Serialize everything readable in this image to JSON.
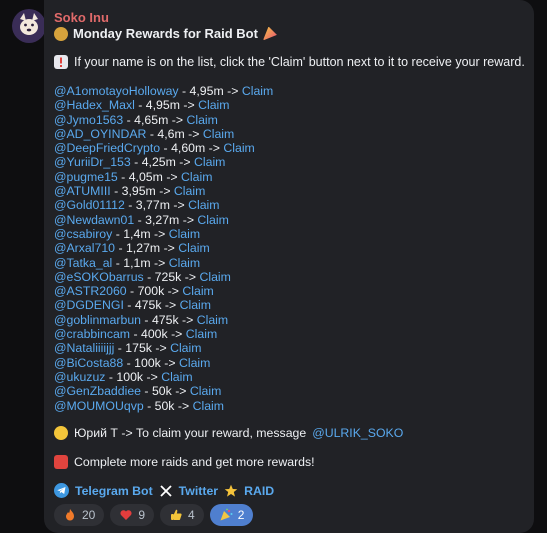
{
  "message": {
    "sender": "Soko Inu",
    "title": "Monday Rewards for Raid Bot",
    "intro": "If your name is on the list, click the 'Claim' button next to it to receive your reward.",
    "arrow": "->",
    "claim_label": "Claim",
    "rewards": [
      {
        "user": "@A1omotayoHolloway",
        "amount": "4,95m"
      },
      {
        "user": "@Hadex_Maxl",
        "amount": "4,95m"
      },
      {
        "user": "@Jymo1563",
        "amount": "4,65m"
      },
      {
        "user": "@AD_OYINDAR",
        "amount": "4,6m"
      },
      {
        "user": "@DeepFriedCrypto",
        "amount": "4,60m"
      },
      {
        "user": "@YuriiDr_153",
        "amount": "4,25m"
      },
      {
        "user": "@pugme15",
        "amount": "4,05m"
      },
      {
        "user": "@ATUMIII",
        "amount": "3,95m"
      },
      {
        "user": "@Gold01112",
        "amount": "3,77m"
      },
      {
        "user": "@Newdawn01",
        "amount": "3,27m"
      },
      {
        "user": "@csabiroy",
        "amount": "1,4m"
      },
      {
        "user": "@Arxal710",
        "amount": "1,27m"
      },
      {
        "user": "@Tatka_al",
        "amount": "1,1m"
      },
      {
        "user": "@eSOKObarrus",
        "amount": "725k"
      },
      {
        "user": "@ASTR2060",
        "amount": "700k"
      },
      {
        "user": "@DGDENGI",
        "amount": "475k"
      },
      {
        "user": "@goblinmarbun",
        "amount": "475k"
      },
      {
        "user": "@crabbincam",
        "amount": "400k"
      },
      {
        "user": "@Nataliiiijjj",
        "amount": "175k"
      },
      {
        "user": "@BiCosta88",
        "amount": "100k"
      },
      {
        "user": "@ukuzuz",
        "amount": "100k"
      },
      {
        "user": "@GenZbaddiee",
        "amount": "50k"
      },
      {
        "user": "@MOUMOUqvp",
        "amount": "50k"
      }
    ],
    "contact_text": "Юрий Т -> To claim your reward, message",
    "contact_handle": "@ULRIK_SOKO",
    "more_text": "Complete more raids and get more rewards!",
    "links": {
      "telegram": "Telegram Bot",
      "twitter": "Twitter",
      "raid": "RAID"
    }
  },
  "reactions": [
    {
      "emoji": "fire",
      "count": "20"
    },
    {
      "emoji": "heart",
      "count": "9"
    },
    {
      "emoji": "thumbs-up",
      "count": "4"
    },
    {
      "emoji": "party-popper",
      "count": "2"
    }
  ]
}
